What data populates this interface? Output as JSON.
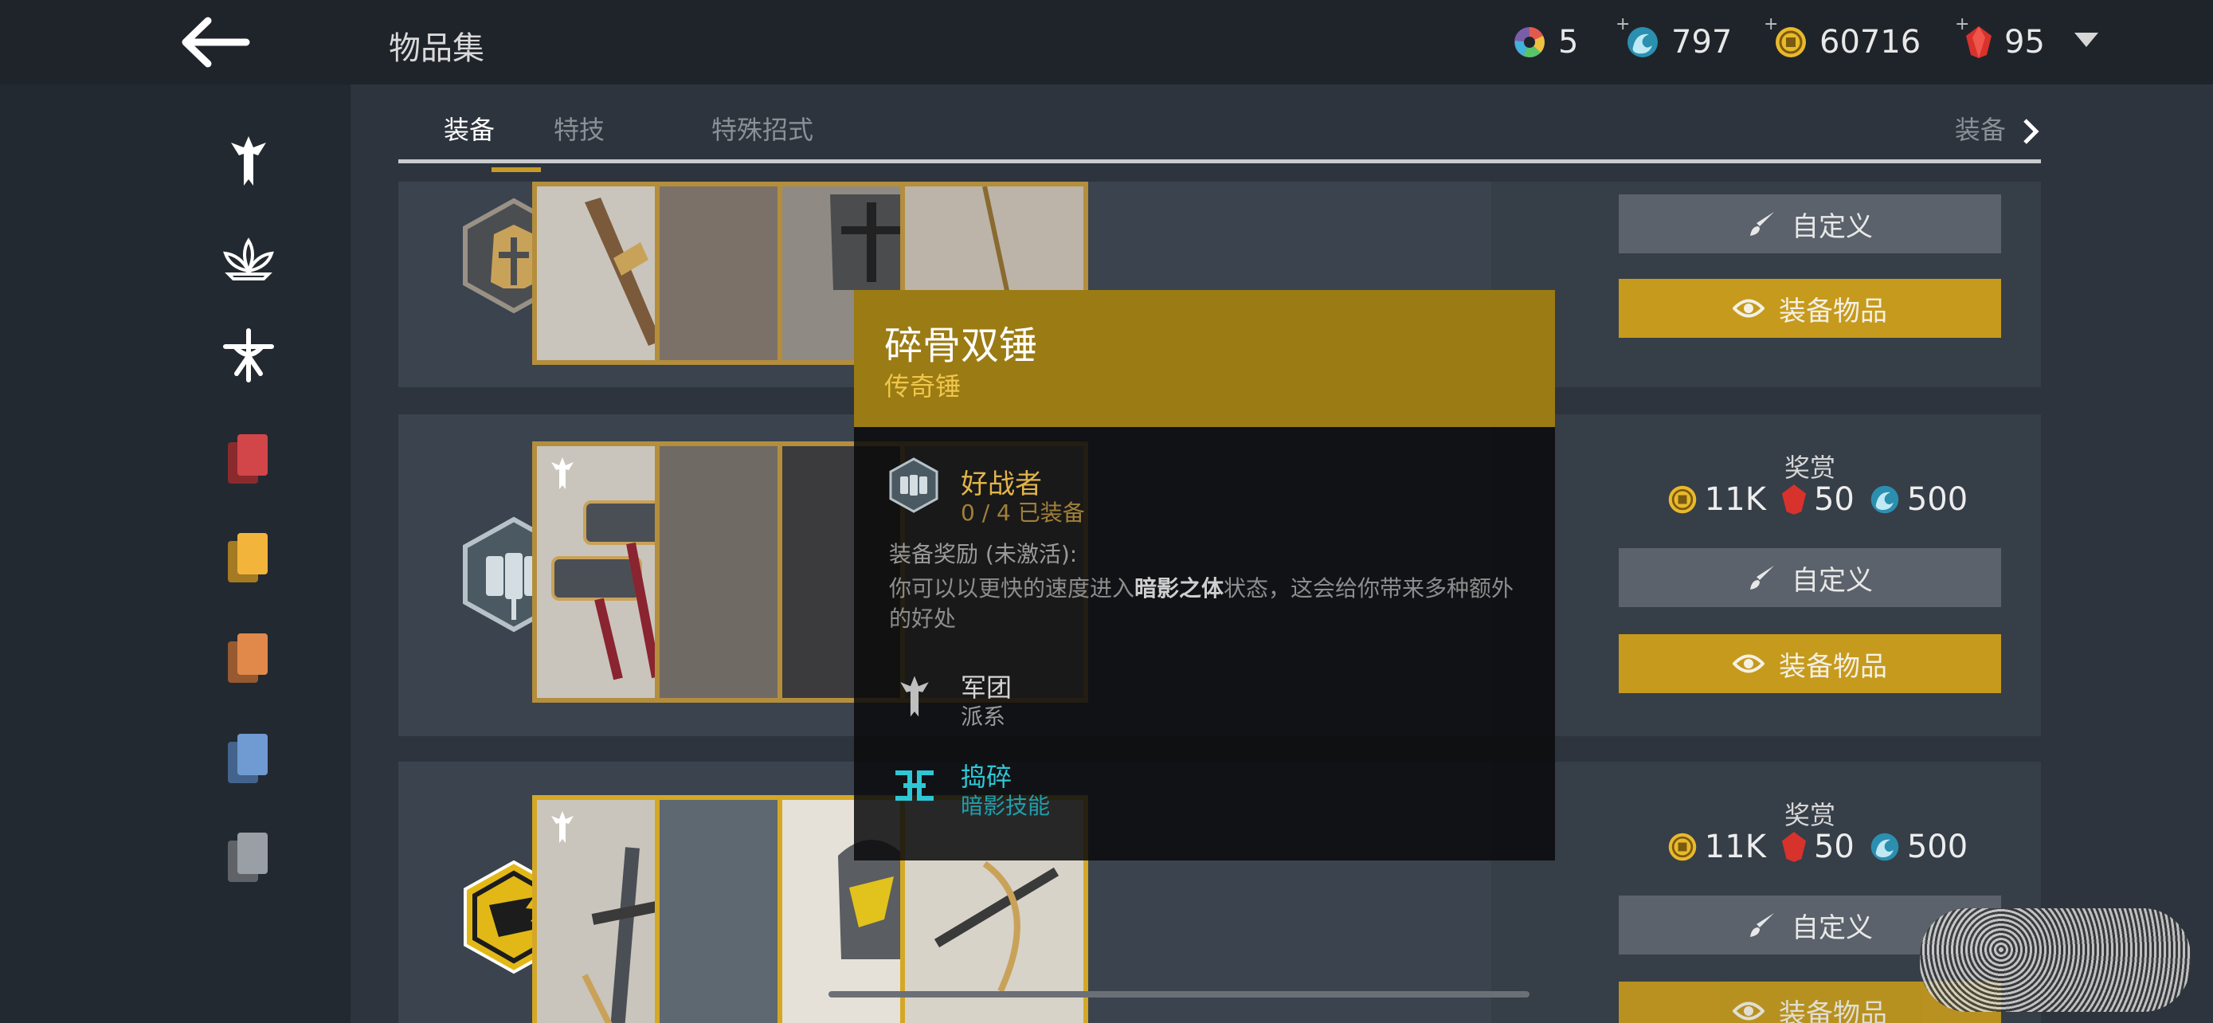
{
  "header": {
    "title": "物品集",
    "currencies": [
      {
        "name": "orb",
        "value": "5",
        "plus": false
      },
      {
        "name": "shadow-energy",
        "value": "797",
        "plus": true
      },
      {
        "name": "coins",
        "value": "60716",
        "plus": true
      },
      {
        "name": "ruby",
        "value": "95",
        "plus": true
      }
    ]
  },
  "sidebar": {
    "items": [
      {
        "icon": "legion-icon"
      },
      {
        "icon": "dynasty-icon"
      },
      {
        "icon": "heralds-icon"
      },
      {
        "icon": "red-cards-icon",
        "color": "#d2464a"
      },
      {
        "icon": "yellow-cards-icon",
        "color": "#f2b43a"
      },
      {
        "icon": "orange-cards-icon",
        "color": "#e0894a"
      },
      {
        "icon": "blue-cards-icon",
        "color": "#6f9ad2"
      },
      {
        "icon": "gray-cards-icon",
        "color": "#9a9ea5"
      }
    ]
  },
  "tabs": {
    "items": [
      "装备",
      "特技",
      "特殊招式"
    ],
    "active": "装备",
    "next_label": "装备"
  },
  "rows": [
    {
      "customize_label": "自定义",
      "equip_label": "装备物品"
    },
    {
      "reward_label": "奖赏",
      "rewards": {
        "coins": "11K",
        "ruby": "50",
        "shadow": "500"
      },
      "customize_label": "自定义",
      "equip_label": "装备物品"
    },
    {
      "reward_label": "奖赏",
      "rewards": {
        "coins": "11K",
        "ruby": "50",
        "shadow": "500"
      },
      "customize_label": "自定义",
      "equip_label": "装备物品"
    }
  ],
  "tooltip": {
    "title": "碎骨双锤",
    "subtitle": "传奇锤",
    "set_name": "好战者",
    "set_count": "0 / 4 已装备",
    "bonus_title": "装备奖励 (未激活):",
    "bonus_text_1": "你可以以更快的速度进入",
    "bonus_text_bold": "暗影之体",
    "bonus_text_2": "状态，这会给你带来多种额外的好处",
    "faction_name": "军团",
    "faction_desc": "派系",
    "skill_name": "捣碎",
    "skill_desc": "暗影技能"
  },
  "colors": {
    "accent_gold": "#c69a1c",
    "tooltip_header": "#9b7b14",
    "skill_cyan": "#2ec7d6"
  }
}
